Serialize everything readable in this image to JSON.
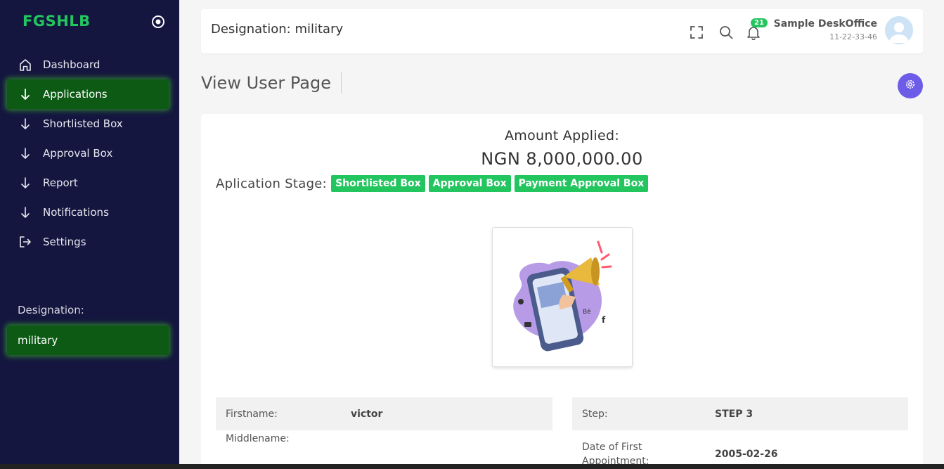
{
  "sidebar": {
    "brand": "FGSHLB",
    "items": [
      {
        "label": "Dashboard",
        "icon": "home-icon"
      },
      {
        "label": "Applications",
        "icon": "arrow-down-icon"
      },
      {
        "label": "Shortlisted Box",
        "icon": "arrow-down-icon"
      },
      {
        "label": "Approval Box",
        "icon": "arrow-down-icon"
      },
      {
        "label": "Report",
        "icon": "arrow-down-icon"
      },
      {
        "label": "Notifications",
        "icon": "arrow-down-icon"
      },
      {
        "label": "Settings",
        "icon": "logout-icon"
      }
    ],
    "active_item": "Applications",
    "designation_label": "Designation:",
    "designation_value": "military"
  },
  "topbar": {
    "title": "Designation: military",
    "notification_count": "21",
    "user_name": "Sample DeskOffice",
    "user_id": "11-22-33-46"
  },
  "page": {
    "title": "View User Page"
  },
  "application": {
    "amount_label": "Amount Applied:",
    "amount_value": "NGN 8,000,000.00",
    "stage_label": "Aplication Stage:",
    "stages": [
      "Shortlisted Box",
      "Approval Box",
      "Payment Approval Box"
    ]
  },
  "details": {
    "firstname_label": "Firstname:",
    "firstname_value": "victor",
    "middlename_label": "Middlename:",
    "middlename_value": "",
    "step_label": "Step:",
    "step_value": "STEP 3",
    "first_appointment_label": "Date of First Appointment:",
    "first_appointment_value": "2005-02-26"
  },
  "colors": {
    "sidebar_bg": "#14163f",
    "brand": "#22c55e",
    "active_bg": "#0c5a14",
    "badge": "#22c55e",
    "fab": "#6c5ce7"
  }
}
